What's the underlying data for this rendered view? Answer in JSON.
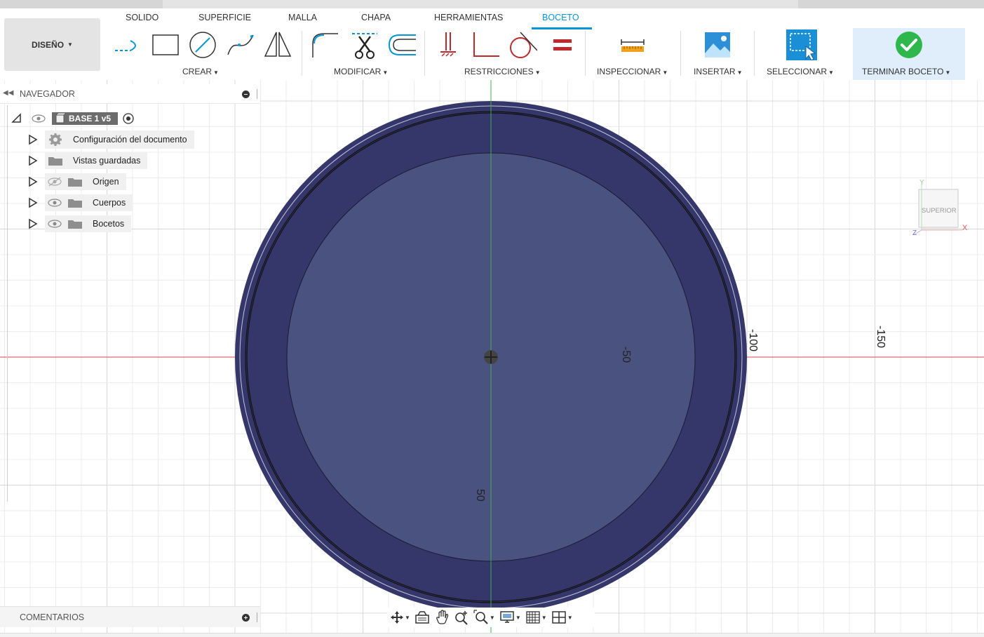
{
  "app": {
    "document_title": "BASE 1 v5",
    "design_label": "DISEÑO"
  },
  "tabs": [
    {
      "label": "SOLIDO"
    },
    {
      "label": "SUPERFICIE"
    },
    {
      "label": "MALLA"
    },
    {
      "label": "CHAPA"
    },
    {
      "label": "HERRAMIENTAS"
    },
    {
      "label": "BOCETO",
      "active": true
    }
  ],
  "toolbar": {
    "groups": {
      "crear": "CREAR",
      "modificar": "MODIFICAR",
      "restricciones": "RESTRICCIONES",
      "inspeccionar": "INSPECCIONAR",
      "insertar": "INSERTAR",
      "seleccionar": "SELECCIONAR",
      "terminar": "TERMINAR BOCETO"
    },
    "icons": {
      "crear": [
        "line-icon",
        "rectangle-icon",
        "circle-icon",
        "spline-icon",
        "mirror-icon"
      ],
      "modificar": [
        "fillet-icon",
        "trim-icon",
        "offset-icon"
      ],
      "restricciones": [
        "fix-icon",
        "perpendicular-icon",
        "tangent-icon",
        "equal-icon"
      ],
      "inspeccionar": [
        "measure-icon"
      ],
      "insertar": [
        "insert-image-icon"
      ],
      "seleccionar": [
        "select-icon"
      ],
      "terminar": [
        "finish-check-icon"
      ]
    }
  },
  "navigator": {
    "title": "NAVEGADOR",
    "root": {
      "label": "BASE 1 v5"
    },
    "items": [
      {
        "label": "Configuración del documento",
        "icon": "gear-icon"
      },
      {
        "label": "Vistas guardadas",
        "icon": "folder-icon"
      },
      {
        "label": "Origen",
        "icon": "folder-icon",
        "visibility": "hidden"
      },
      {
        "label": "Cuerpos",
        "icon": "folder-icon",
        "visibility": "visible"
      },
      {
        "label": "Bocetos",
        "icon": "folder-icon",
        "visibility": "visible"
      }
    ]
  },
  "comments": {
    "title": "COMENTARIOS"
  },
  "viewcube": {
    "face_label": "SUPERIOR",
    "axes": {
      "x": "X",
      "y": "Y",
      "z": "Z"
    }
  },
  "viewport": {
    "axis_labels": [
      "-50",
      "-100",
      "-150",
      "50"
    ]
  },
  "colors": {
    "accent": "#0696d7",
    "sketch_outer": "#35366a",
    "sketch_inner": "#4a5380",
    "x_axis": "#e04040",
    "y_axis": "#3cb04c",
    "grid": "#e6e6e6",
    "finish_check": "#2eb84c"
  },
  "bottom_bar": {
    "tools": [
      "orbit-icon",
      "look-at-icon",
      "pan-icon",
      "zoom-icon",
      "fit-icon",
      "display-settings-icon",
      "grid-settings-icon",
      "viewports-icon"
    ]
  }
}
